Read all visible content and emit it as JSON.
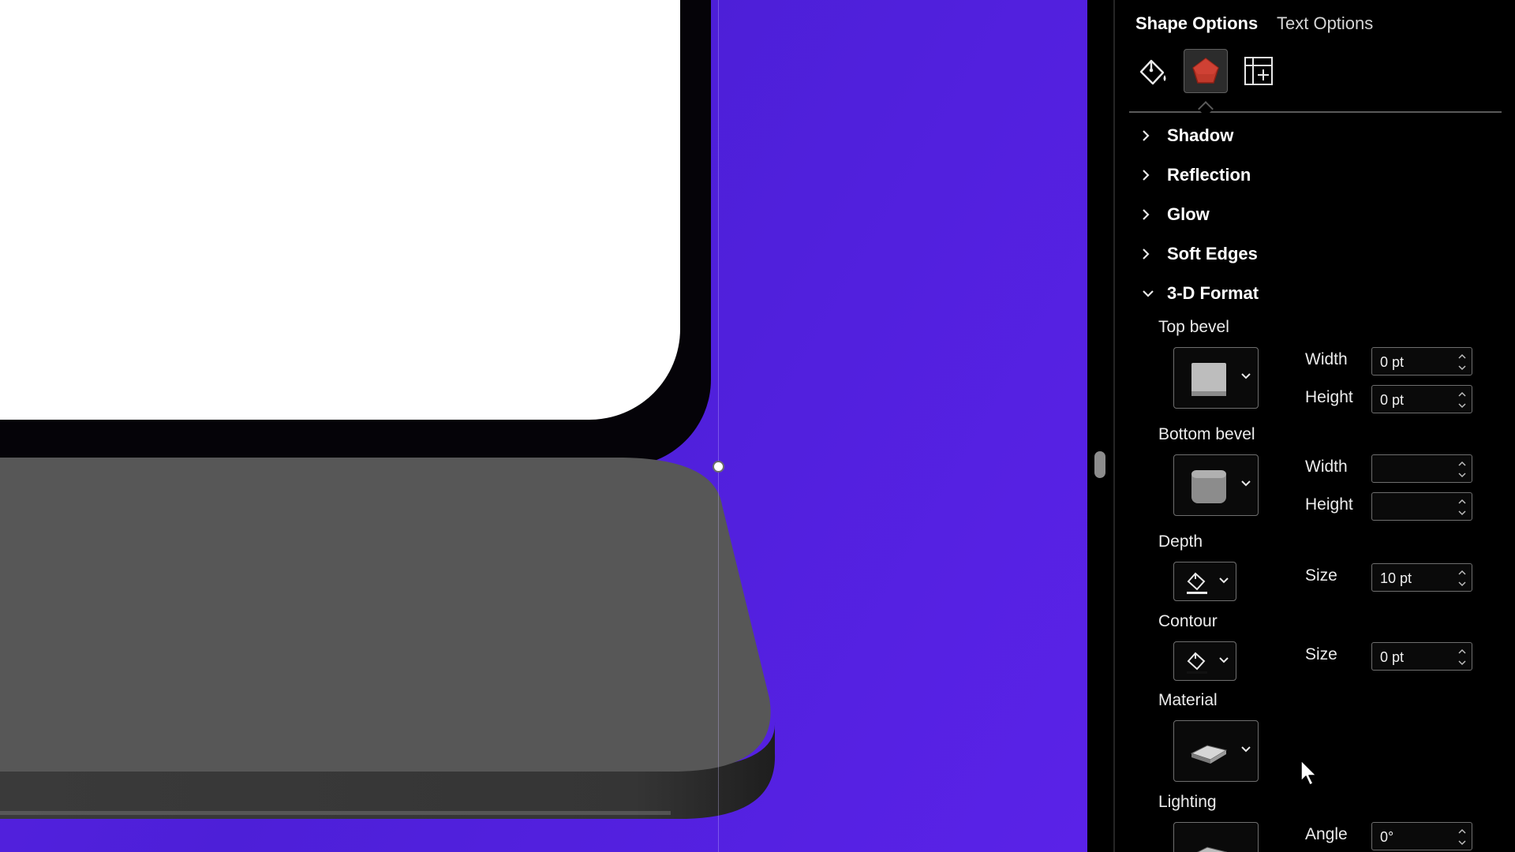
{
  "tabs": {
    "shape_options": "Shape Options",
    "text_options": "Text Options"
  },
  "categories": [
    {
      "name": "fill-and-line",
      "icon": "paint-bucket-icon"
    },
    {
      "name": "effects",
      "icon": "pentagon-icon",
      "selected": true,
      "color": "#c0392b"
    },
    {
      "name": "size-and-properties",
      "icon": "size-properties-icon"
    }
  ],
  "sections": {
    "shadow": "Shadow",
    "reflection": "Reflection",
    "glow": "Glow",
    "soft_edges": "Soft Edges",
    "three_d_format": "3-D Format"
  },
  "format3d": {
    "top_bevel": {
      "label": "Top bevel",
      "width_label": "Width",
      "width_value": "0 pt",
      "height_label": "Height",
      "height_value": "0 pt"
    },
    "bottom_bevel": {
      "label": "Bottom bevel",
      "width_label": "Width",
      "width_value": "",
      "height_label": "Height",
      "height_value": ""
    },
    "depth": {
      "label": "Depth",
      "size_label": "Size",
      "size_value": "10 pt"
    },
    "contour": {
      "label": "Contour",
      "size_label": "Size",
      "size_value": "0 pt"
    },
    "material": {
      "label": "Material"
    },
    "lighting": {
      "label": "Lighting",
      "angle_label": "Angle",
      "angle_value": "0°"
    }
  },
  "colors": {
    "canvas_background": "#4d1fd8",
    "screen_bezel": "#050308",
    "screen_display": "#ffffff",
    "keyboard_base": "#555555",
    "pane_background": "#000000",
    "accent_selected_icon": "#c0392b"
  }
}
